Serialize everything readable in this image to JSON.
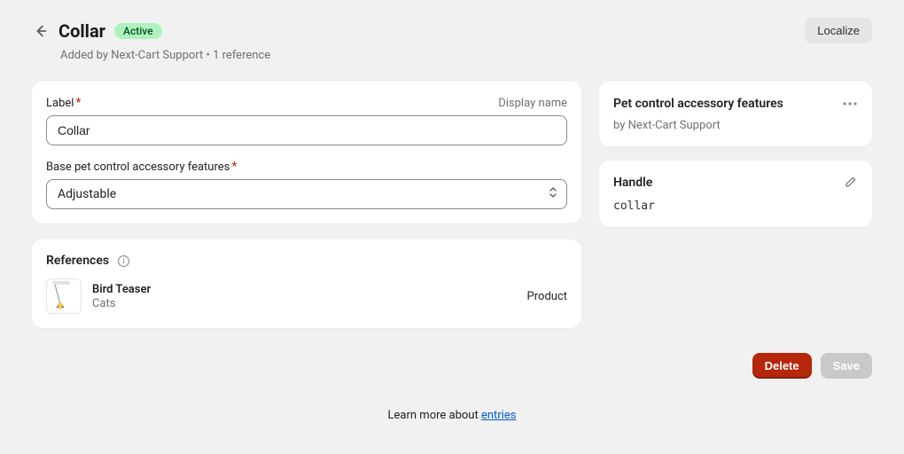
{
  "header": {
    "title": "Collar",
    "status_badge": "Active",
    "subline": "Added by Next-Cart Support • 1 reference",
    "localize_label": "Localize"
  },
  "form": {
    "label_field": {
      "label": "Label",
      "hint": "Display name",
      "value": "Collar"
    },
    "base_field": {
      "label": "Base pet control accessory features",
      "value": "Adjustable"
    }
  },
  "references": {
    "heading": "References",
    "items": [
      {
        "title": "Bird Teaser",
        "subtitle": "Cats",
        "type": "Product"
      }
    ]
  },
  "sidebar": {
    "definition": {
      "title": "Pet control accessory features",
      "byline": "by Next-Cart Support"
    },
    "handle": {
      "title": "Handle",
      "value": "collar"
    }
  },
  "actions": {
    "delete": "Delete",
    "save": "Save"
  },
  "footer": {
    "learn_prefix": "Learn more about ",
    "learn_link": "entries"
  }
}
